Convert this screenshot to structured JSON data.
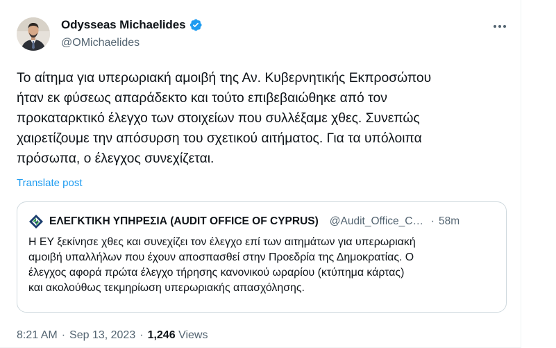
{
  "author": {
    "name": "Odysseas Michaelides",
    "handle": "@OMichaelides",
    "verified_icon": "verified-badge-icon",
    "verified_color": "#1d9bf0"
  },
  "more_icon": "more-horizontal-icon",
  "tweet": {
    "text": "Το αίτημα για υπερωριακή αμοιβή της Αν. Κυβερνητικής Εκπροσώπου\nήταν εκ φύσεως απαράδεκτο και τούτο επιβεβαιώθηκε από τον\nπροκαταρκτικό έλεγχο των στοιχείων που συλλέξαμε χθες. Συνεπώς\nχαιρετίζουμε την απόσυρση του σχετικού αιτήματος. Για τα υπόλοιπα\nπρόσωπα, ο έλεγχος συνεχίζεται.",
    "translate_label": "Translate post"
  },
  "quote": {
    "logo_icon": "audit-office-logo-icon",
    "name": "ΕΛΕΓΚΤΙΚΗ ΥΠΗΡΕΣΙΑ (AUDIT OFFICE OF CYPRUS)",
    "handle": "@Audit_Office_Cyprus",
    "dot": "·",
    "time": "58m",
    "text": "Η ΕΥ ξεκίνησε χθες και συνεχίζει τον έλεγχο επί των αιτημάτων για υπερωριακή\nαμοιβή υπαλλήλων που έχουν αποσπασθεί στην Προεδρία της Δημοκρατίας. Ο\nέλεγχος αφορά πρώτα έλεγχο τήρησης κανονικού ωραρίου (κτύπημα κάρτας)\nκαι ακολούθως τεκμηρίωση υπερωριακής απασχόλησης."
  },
  "meta": {
    "time": "8:21 AM",
    "date": "Sep 13, 2023",
    "separator": "·",
    "views_count": "1,246",
    "views_label": "Views"
  },
  "colors": {
    "link": "#1d9bf0",
    "secondary_text": "#536471",
    "border": "#cfd9de"
  }
}
